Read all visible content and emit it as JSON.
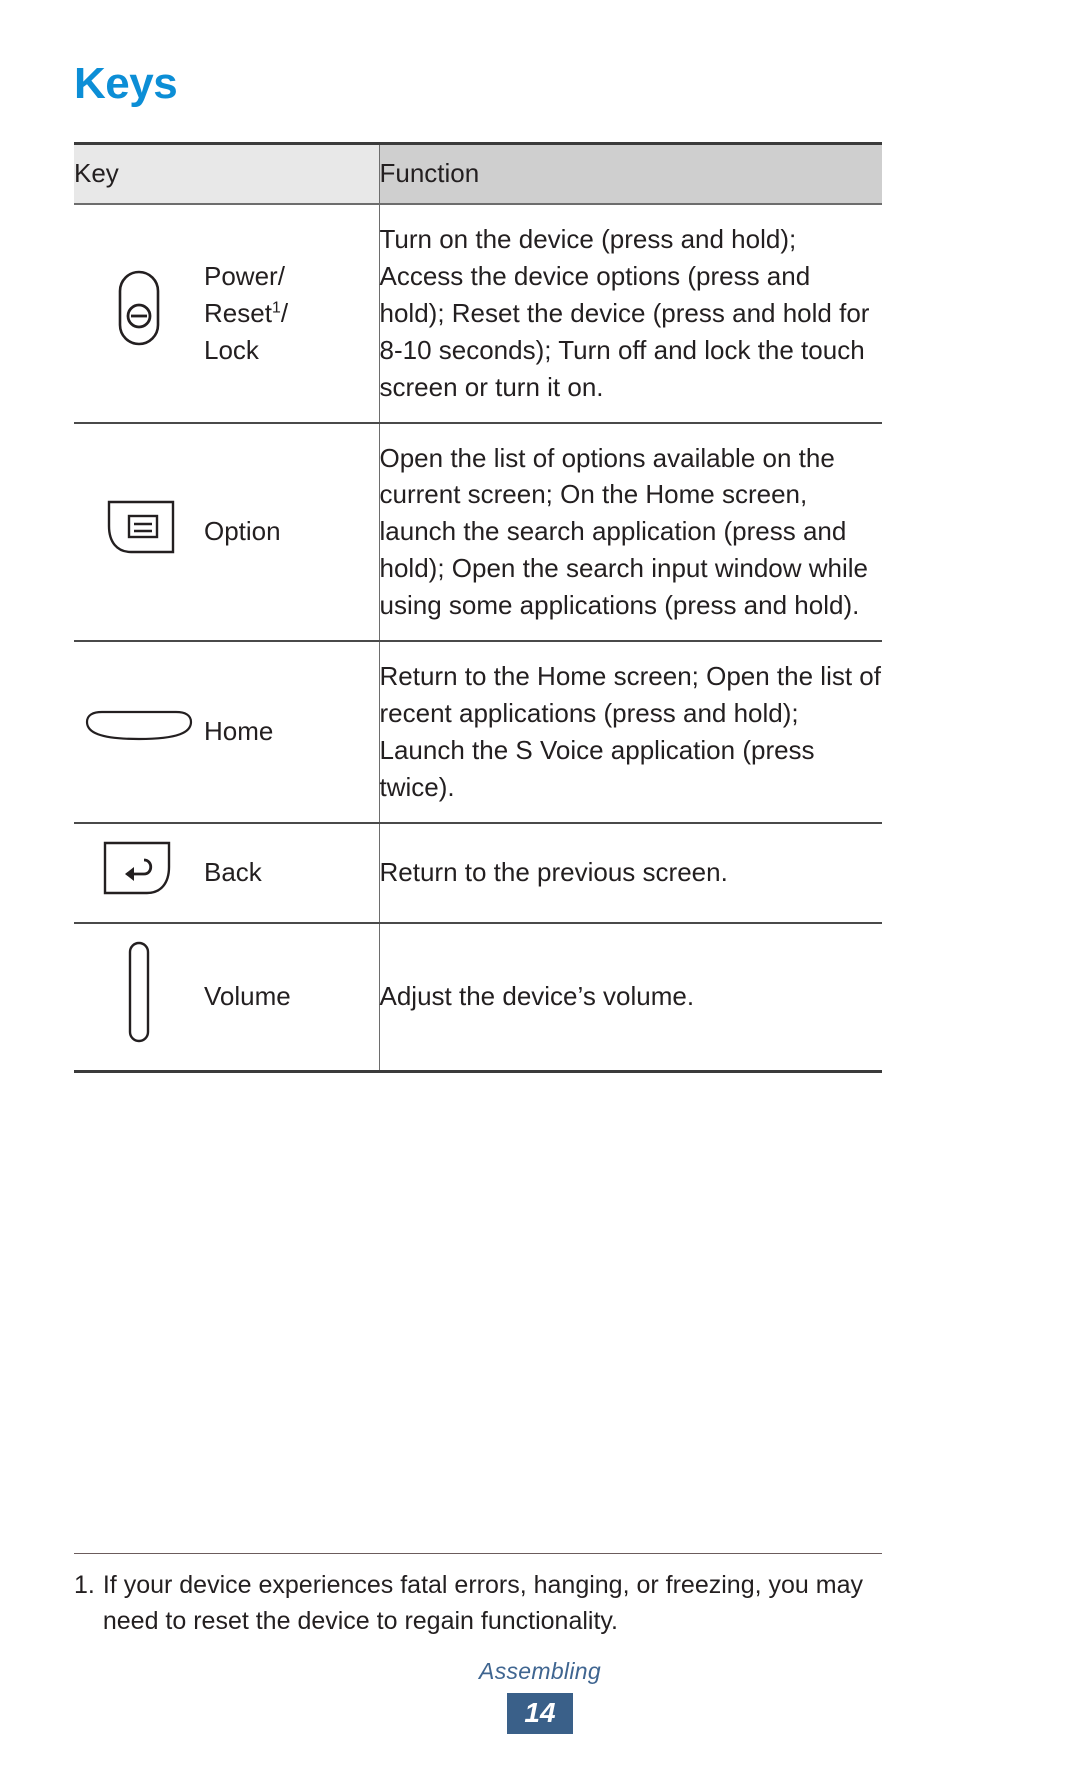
{
  "page": {
    "title": "Keys",
    "section": "Assembling",
    "page_number": "14",
    "title_color": "#0c8ed6",
    "footer_badge_color": "#3a6089",
    "footer_text_color": "#3f6590"
  },
  "table": {
    "headers": {
      "key": "Key",
      "function": "Function"
    },
    "header_key_bg": "#e8e8e8",
    "header_function_bg": "#cfcfcf",
    "rows": [
      {
        "icon": "power-key-icon",
        "label_html": "Power/<br>Reset<sup class=\"fn\">1</sup>/<br>Lock",
        "label_text": "Power/ Reset1/ Lock",
        "function": "Turn on the device (press and hold); Access the device options (press and hold); Reset the device (press and hold for 8-10 seconds); Turn off and lock the touch screen or turn it on."
      },
      {
        "icon": "option-key-icon",
        "label_html": "Option",
        "label_text": "Option",
        "function": "Open the list of options available on the current screen; On the Home screen, launch the search application (press and hold); Open the search input window while using some applications (press and hold)."
      },
      {
        "icon": "home-key-icon",
        "label_html": "Home",
        "label_text": "Home",
        "function": "Return to the Home screen; Open the list of recent applications (press and hold); Launch the S Voice application (press twice)."
      },
      {
        "icon": "back-key-icon",
        "label_html": "Back",
        "label_text": "Back",
        "function": "Return to the previous screen."
      },
      {
        "icon": "volume-key-icon",
        "label_html": "Volume",
        "label_text": "Volume",
        "function": "Adjust the device’s volume."
      }
    ]
  },
  "footnote": {
    "number": "1.",
    "text": "If your device experiences fatal errors, hanging, or freezing, you may need to reset the device to regain functionality."
  }
}
